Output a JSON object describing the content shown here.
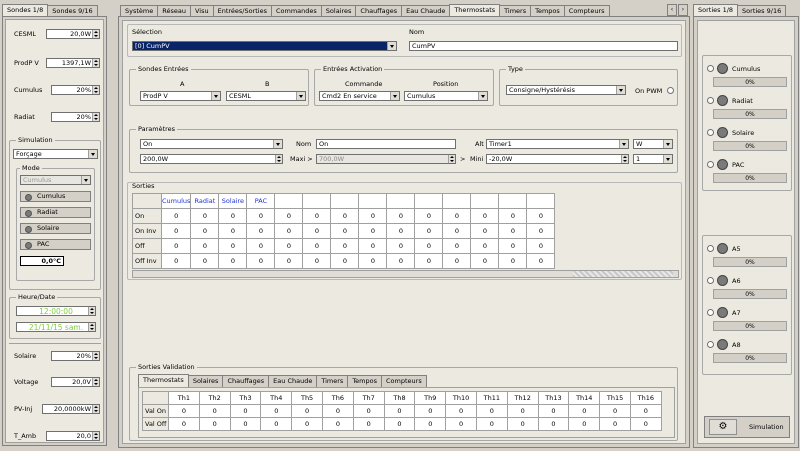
{
  "left": {
    "tabs": [
      "Sondes 1/8",
      "Sondes 9/16"
    ],
    "probes": [
      {
        "label": "CESML",
        "value": "20,0W"
      },
      {
        "label": "ProdP V",
        "value": "1397,1W"
      },
      {
        "label": "Cumulus",
        "value": "20%"
      },
      {
        "label": "Radiat",
        "value": "20%"
      }
    ],
    "simulation": {
      "title": "Simulation",
      "mode_combo": "Forçage",
      "mode_title": "Mode",
      "mode_combo2": "Cumulus",
      "buttons": [
        "Cumulus",
        "Radiat",
        "Solaire",
        "PAC"
      ],
      "temp": "0,0°C"
    },
    "datetime": {
      "title": "Heure/Date",
      "time": "12:00:00",
      "date": "21/11/15 sam."
    },
    "probes2": [
      {
        "label": "Solaire",
        "value": "20%"
      },
      {
        "label": "Voltage",
        "value": "20,0V"
      },
      {
        "label": "PV-Inj",
        "value": "20,0000kW"
      },
      {
        "label": "T_Amb",
        "value": "20,0"
      }
    ]
  },
  "main": {
    "tabs": [
      "Système",
      "Réseau",
      "Visu",
      "Entrées/Sorties",
      "Commandes",
      "Solaires",
      "Chauffages",
      "Eau Chaude",
      "Thermostats",
      "Timers",
      "Tempos",
      "Compteurs"
    ],
    "active_tab": "Thermostats",
    "selection": {
      "label": "Sélection",
      "value": "[0] CumPV",
      "nom_label": "Nom",
      "nom_value": "CumPV"
    },
    "sondes": {
      "title": "Sondes Entrées",
      "a_label": "A",
      "b_label": "B",
      "a_value": "ProdP V",
      "b_value": "CESML"
    },
    "activation": {
      "title": "Entrées Activation",
      "cmd_label": "Commande",
      "pos_label": "Position",
      "cmd_value": "Cmd2 En service",
      "pos_value": "Cumulus"
    },
    "type": {
      "title": "Type",
      "value": "Consigne/Hystérésis",
      "pwm_label": "On PWM"
    },
    "params": {
      "title": "Paramètres",
      "c1": "On",
      "c2": "200,0W",
      "nom_label": "Nom",
      "nom_value": "On",
      "maxi_label": "Maxi >",
      "maxi_value": "700,0W",
      "gt": ">",
      "alt_label": "Alt",
      "alt_value": "Timer1",
      "unit_value": "W",
      "mini_label": "Mini",
      "mini_value": "-20,0W",
      "num_value": "1"
    },
    "sorties": {
      "title": "Sorties",
      "headers": [
        "Cumulus",
        "Radiat",
        "Solaire",
        "PAC"
      ],
      "rows": [
        {
          "label": "On",
          "values": [
            "0",
            "0",
            "0",
            "0",
            "0",
            "0",
            "0",
            "0",
            "0",
            "0",
            "0",
            "0",
            "0",
            "0"
          ]
        },
        {
          "label": "On Inv",
          "values": [
            "0",
            "0",
            "0",
            "0",
            "0",
            "0",
            "0",
            "0",
            "0",
            "0",
            "0",
            "0",
            "0",
            "0"
          ]
        },
        {
          "label": "Off",
          "values": [
            "0",
            "0",
            "0",
            "0",
            "0",
            "0",
            "0",
            "0",
            "0",
            "0",
            "0",
            "0",
            "0",
            "0"
          ]
        },
        {
          "label": "Off Inv",
          "values": [
            "0",
            "0",
            "0",
            "0",
            "0",
            "0",
            "0",
            "0",
            "0",
            "0",
            "0",
            "0",
            "0",
            "0"
          ]
        }
      ]
    },
    "validation": {
      "title": "Sorties Validation",
      "tabs": [
        "Thermostats",
        "Solaires",
        "Chauffages",
        "Eau Chaude",
        "Timers",
        "Tempos",
        "Compteurs"
      ],
      "headers": [
        "Th1",
        "Th2",
        "Th3",
        "Th4",
        "Th5",
        "Th6",
        "Th7",
        "Th8",
        "Th9",
        "Th10",
        "Th11",
        "Th12",
        "Th13",
        "Th14",
        "Th15",
        "Th16"
      ],
      "rows": [
        {
          "label": "Val On",
          "values": [
            "0",
            "0",
            "0",
            "0",
            "0",
            "0",
            "0",
            "0",
            "0",
            "0",
            "0",
            "0",
            "0",
            "0",
            "0",
            "0"
          ]
        },
        {
          "label": "Val Off",
          "values": [
            "0",
            "0",
            "0",
            "0",
            "0",
            "0",
            "0",
            "0",
            "0",
            "0",
            "0",
            "0",
            "0",
            "0",
            "0",
            "0"
          ]
        }
      ]
    }
  },
  "right": {
    "tabs": [
      "Sorties 1/8",
      "Sorties 9/16"
    ],
    "outputs1": [
      {
        "label": "Cumulus",
        "pct": "0%"
      },
      {
        "label": "Radiat",
        "pct": "0%"
      },
      {
        "label": "Solaire",
        "pct": "0%"
      },
      {
        "label": "PAC",
        "pct": "0%"
      }
    ],
    "outputs2": [
      {
        "label": "A5",
        "pct": "0%"
      },
      {
        "label": "A6",
        "pct": "0%"
      },
      {
        "label": "A7",
        "pct": "0%"
      },
      {
        "label": "A8",
        "pct": "0%"
      }
    ],
    "sim_button": "Simulation"
  }
}
